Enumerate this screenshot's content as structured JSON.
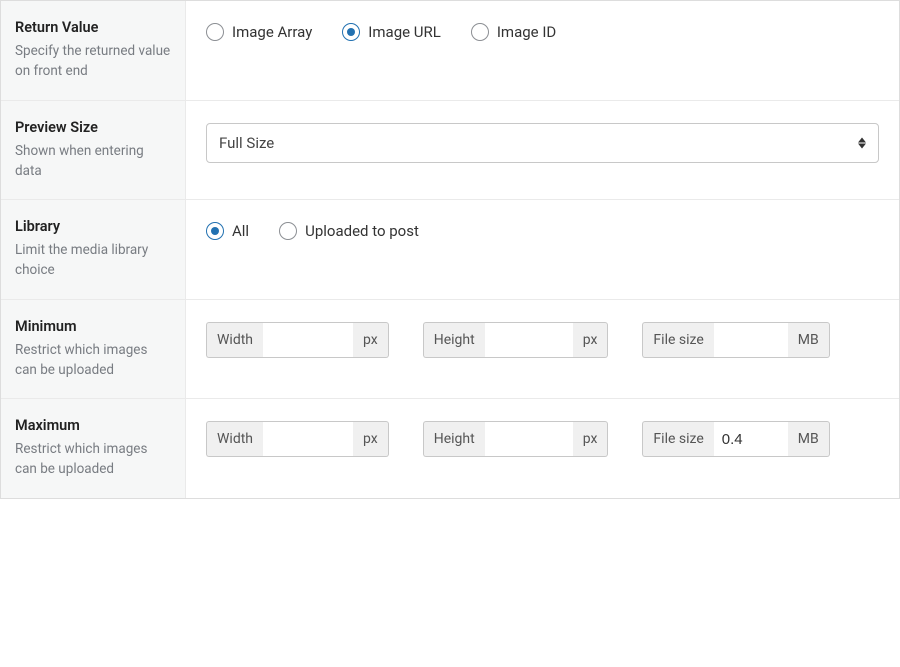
{
  "return_value": {
    "title": "Return Value",
    "desc": "Specify the returned value on front end",
    "options": {
      "array": "Image Array",
      "url": "Image URL",
      "id": "Image ID"
    },
    "selected": "url"
  },
  "preview_size": {
    "title": "Preview Size",
    "desc": "Shown when entering data",
    "value": "Full Size"
  },
  "library": {
    "title": "Library",
    "desc": "Limit the media library choice",
    "options": {
      "all": "All",
      "uploaded": "Uploaded to post"
    },
    "selected": "all"
  },
  "minimum": {
    "title": "Minimum",
    "desc": "Restrict which images can be uploaded",
    "width_label": "Width",
    "width_unit": "px",
    "width_value": "",
    "height_label": "Height",
    "height_unit": "px",
    "height_value": "",
    "filesize_label": "File size",
    "filesize_unit": "MB",
    "filesize_value": ""
  },
  "maximum": {
    "title": "Maximum",
    "desc": "Restrict which images can be uploaded",
    "width_label": "Width",
    "width_unit": "px",
    "width_value": "",
    "height_label": "Height",
    "height_unit": "px",
    "height_value": "",
    "filesize_label": "File size",
    "filesize_unit": "MB",
    "filesize_value": "0.4"
  }
}
